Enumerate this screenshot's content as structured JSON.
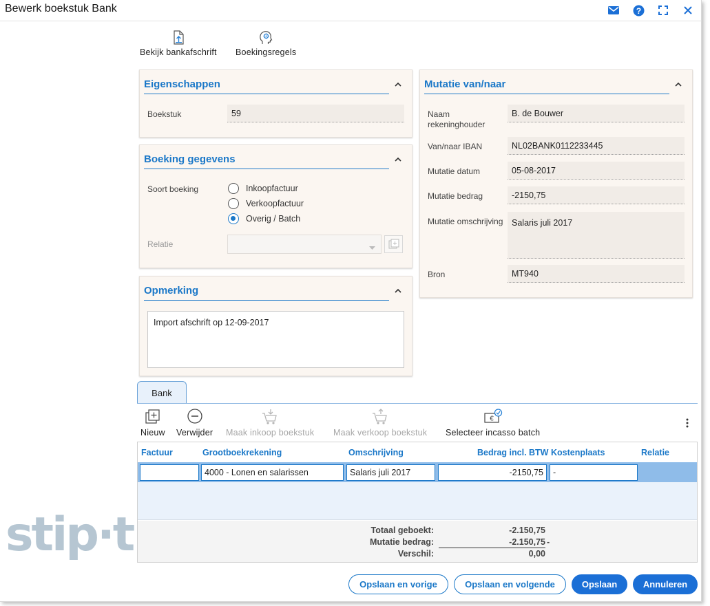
{
  "window": {
    "title": "Bewerk boekstuk Bank"
  },
  "toolbar": {
    "bankafschrift": "Bekijk bankafschrift",
    "boekingsregels": "Boekingsregels"
  },
  "eigenschappen": {
    "title": "Eigenschappen",
    "boekstuk_label": "Boekstuk",
    "boekstuk_value": "59"
  },
  "boeking": {
    "title": "Boeking gegevens",
    "soort_label": "Soort boeking",
    "options": [
      "Inkoopfactuur",
      "Verkoopfactuur",
      "Overig / Batch"
    ],
    "selected_option": "Overig / Batch",
    "relatie_label": "Relatie",
    "relatie_value": ""
  },
  "opmerking": {
    "title": "Opmerking",
    "text": "Import afschrift op 12-09-2017"
  },
  "mutatie": {
    "title": "Mutatie van/naar",
    "naam_label_1": "Naam",
    "naam_label_2": "rekeninghouder",
    "naam_value": "B. de Bouwer",
    "iban_label": "Van/naar IBAN",
    "iban_value": "NL02BANK0112233445",
    "datum_label": "Mutatie datum",
    "datum_value": "05-08-2017",
    "bedrag_label": "Mutatie bedrag",
    "bedrag_value": "-2150,75",
    "omschrijving_label": "Mutatie omschrijving",
    "omschrijving_value": "Salaris juli 2017",
    "bron_label": "Bron",
    "bron_value": "MT940"
  },
  "tabs": {
    "bank": "Bank"
  },
  "lines_toolbar": {
    "nieuw": "Nieuw",
    "verwijder": "Verwijder",
    "maak_inkoop": "Maak inkoop boekstuk",
    "maak_verkoop": "Maak verkoop boekstuk",
    "selecteer_incasso": "Selecteer incasso batch"
  },
  "grid": {
    "columns": [
      "Factuur",
      "Grootboekrekening",
      "Omschrijving",
      "Bedrag incl. BTW",
      "Kostenplaats",
      "Relatie"
    ],
    "row": {
      "factuur": "",
      "grootboek": "4000 - Lonen en salarissen",
      "omschrijving": "Salaris juli 2017",
      "bedrag": "-2150,75",
      "kostenplaats": "-"
    },
    "totals": {
      "totaal_label": "Totaal geboekt:",
      "totaal_value": "-2.150,75",
      "mutatie_label": "Mutatie bedrag:",
      "mutatie_value": "-2.150,75",
      "mutatie_sign": "-",
      "verschil_label": "Verschil:",
      "verschil_value": "0,00"
    }
  },
  "buttons": {
    "vorige": "Opslaan en vorige",
    "volgende": "Opslaan en volgende",
    "opslaan": "Opslaan",
    "annuleren": "Annuleren"
  },
  "brand": {
    "logo": "stip·t"
  },
  "colors": {
    "accent": "#1b78c8",
    "button_fill": "#1b6fd6",
    "panel_bg": "#fbf6f1",
    "selected_row": "#8fbce9"
  },
  "icons": [
    "mail-icon",
    "help-icon",
    "maximize-icon",
    "close-icon",
    "document-upload-icon",
    "head-gear-icon",
    "add-line-icon",
    "remove-line-icon",
    "cart-down-icon",
    "cart-up-icon",
    "euro-check-icon",
    "more-vertical-icon",
    "chevron-up-icon",
    "dropdown-arrow-icon",
    "add-relation-icon"
  ]
}
